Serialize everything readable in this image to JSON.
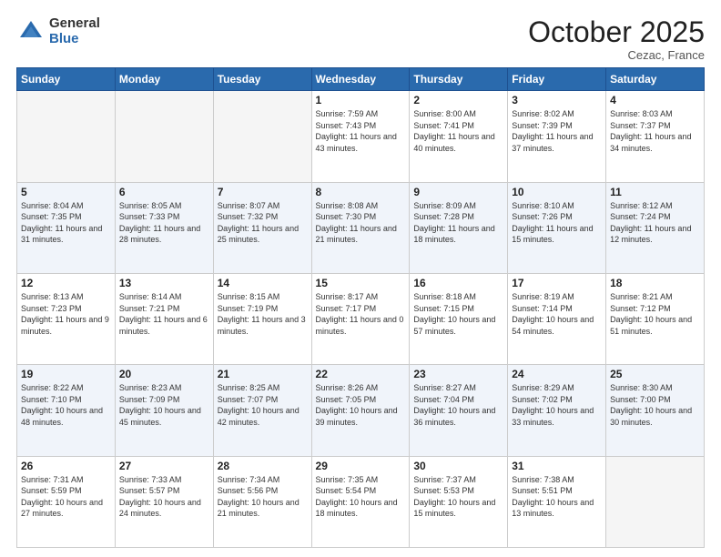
{
  "logo": {
    "general": "General",
    "blue": "Blue"
  },
  "header": {
    "month": "October 2025",
    "location": "Cezac, France"
  },
  "days_of_week": [
    "Sunday",
    "Monday",
    "Tuesday",
    "Wednesday",
    "Thursday",
    "Friday",
    "Saturday"
  ],
  "weeks": [
    [
      {
        "day": "",
        "empty": true
      },
      {
        "day": "",
        "empty": true
      },
      {
        "day": "",
        "empty": true
      },
      {
        "day": "1",
        "sunrise": "Sunrise: 7:59 AM",
        "sunset": "Sunset: 7:43 PM",
        "daylight": "Daylight: 11 hours and 43 minutes."
      },
      {
        "day": "2",
        "sunrise": "Sunrise: 8:00 AM",
        "sunset": "Sunset: 7:41 PM",
        "daylight": "Daylight: 11 hours and 40 minutes."
      },
      {
        "day": "3",
        "sunrise": "Sunrise: 8:02 AM",
        "sunset": "Sunset: 7:39 PM",
        "daylight": "Daylight: 11 hours and 37 minutes."
      },
      {
        "day": "4",
        "sunrise": "Sunrise: 8:03 AM",
        "sunset": "Sunset: 7:37 PM",
        "daylight": "Daylight: 11 hours and 34 minutes."
      }
    ],
    [
      {
        "day": "5",
        "sunrise": "Sunrise: 8:04 AM",
        "sunset": "Sunset: 7:35 PM",
        "daylight": "Daylight: 11 hours and 31 minutes."
      },
      {
        "day": "6",
        "sunrise": "Sunrise: 8:05 AM",
        "sunset": "Sunset: 7:33 PM",
        "daylight": "Daylight: 11 hours and 28 minutes."
      },
      {
        "day": "7",
        "sunrise": "Sunrise: 8:07 AM",
        "sunset": "Sunset: 7:32 PM",
        "daylight": "Daylight: 11 hours and 25 minutes."
      },
      {
        "day": "8",
        "sunrise": "Sunrise: 8:08 AM",
        "sunset": "Sunset: 7:30 PM",
        "daylight": "Daylight: 11 hours and 21 minutes."
      },
      {
        "day": "9",
        "sunrise": "Sunrise: 8:09 AM",
        "sunset": "Sunset: 7:28 PM",
        "daylight": "Daylight: 11 hours and 18 minutes."
      },
      {
        "day": "10",
        "sunrise": "Sunrise: 8:10 AM",
        "sunset": "Sunset: 7:26 PM",
        "daylight": "Daylight: 11 hours and 15 minutes."
      },
      {
        "day": "11",
        "sunrise": "Sunrise: 8:12 AM",
        "sunset": "Sunset: 7:24 PM",
        "daylight": "Daylight: 11 hours and 12 minutes."
      }
    ],
    [
      {
        "day": "12",
        "sunrise": "Sunrise: 8:13 AM",
        "sunset": "Sunset: 7:23 PM",
        "daylight": "Daylight: 11 hours and 9 minutes."
      },
      {
        "day": "13",
        "sunrise": "Sunrise: 8:14 AM",
        "sunset": "Sunset: 7:21 PM",
        "daylight": "Daylight: 11 hours and 6 minutes."
      },
      {
        "day": "14",
        "sunrise": "Sunrise: 8:15 AM",
        "sunset": "Sunset: 7:19 PM",
        "daylight": "Daylight: 11 hours and 3 minutes."
      },
      {
        "day": "15",
        "sunrise": "Sunrise: 8:17 AM",
        "sunset": "Sunset: 7:17 PM",
        "daylight": "Daylight: 11 hours and 0 minutes."
      },
      {
        "day": "16",
        "sunrise": "Sunrise: 8:18 AM",
        "sunset": "Sunset: 7:15 PM",
        "daylight": "Daylight: 10 hours and 57 minutes."
      },
      {
        "day": "17",
        "sunrise": "Sunrise: 8:19 AM",
        "sunset": "Sunset: 7:14 PM",
        "daylight": "Daylight: 10 hours and 54 minutes."
      },
      {
        "day": "18",
        "sunrise": "Sunrise: 8:21 AM",
        "sunset": "Sunset: 7:12 PM",
        "daylight": "Daylight: 10 hours and 51 minutes."
      }
    ],
    [
      {
        "day": "19",
        "sunrise": "Sunrise: 8:22 AM",
        "sunset": "Sunset: 7:10 PM",
        "daylight": "Daylight: 10 hours and 48 minutes."
      },
      {
        "day": "20",
        "sunrise": "Sunrise: 8:23 AM",
        "sunset": "Sunset: 7:09 PM",
        "daylight": "Daylight: 10 hours and 45 minutes."
      },
      {
        "day": "21",
        "sunrise": "Sunrise: 8:25 AM",
        "sunset": "Sunset: 7:07 PM",
        "daylight": "Daylight: 10 hours and 42 minutes."
      },
      {
        "day": "22",
        "sunrise": "Sunrise: 8:26 AM",
        "sunset": "Sunset: 7:05 PM",
        "daylight": "Daylight: 10 hours and 39 minutes."
      },
      {
        "day": "23",
        "sunrise": "Sunrise: 8:27 AM",
        "sunset": "Sunset: 7:04 PM",
        "daylight": "Daylight: 10 hours and 36 minutes."
      },
      {
        "day": "24",
        "sunrise": "Sunrise: 8:29 AM",
        "sunset": "Sunset: 7:02 PM",
        "daylight": "Daylight: 10 hours and 33 minutes."
      },
      {
        "day": "25",
        "sunrise": "Sunrise: 8:30 AM",
        "sunset": "Sunset: 7:00 PM",
        "daylight": "Daylight: 10 hours and 30 minutes."
      }
    ],
    [
      {
        "day": "26",
        "sunrise": "Sunrise: 7:31 AM",
        "sunset": "Sunset: 5:59 PM",
        "daylight": "Daylight: 10 hours and 27 minutes."
      },
      {
        "day": "27",
        "sunrise": "Sunrise: 7:33 AM",
        "sunset": "Sunset: 5:57 PM",
        "daylight": "Daylight: 10 hours and 24 minutes."
      },
      {
        "day": "28",
        "sunrise": "Sunrise: 7:34 AM",
        "sunset": "Sunset: 5:56 PM",
        "daylight": "Daylight: 10 hours and 21 minutes."
      },
      {
        "day": "29",
        "sunrise": "Sunrise: 7:35 AM",
        "sunset": "Sunset: 5:54 PM",
        "daylight": "Daylight: 10 hours and 18 minutes."
      },
      {
        "day": "30",
        "sunrise": "Sunrise: 7:37 AM",
        "sunset": "Sunset: 5:53 PM",
        "daylight": "Daylight: 10 hours and 15 minutes."
      },
      {
        "day": "31",
        "sunrise": "Sunrise: 7:38 AM",
        "sunset": "Sunset: 5:51 PM",
        "daylight": "Daylight: 10 hours and 13 minutes."
      },
      {
        "day": "",
        "empty": true
      }
    ]
  ]
}
